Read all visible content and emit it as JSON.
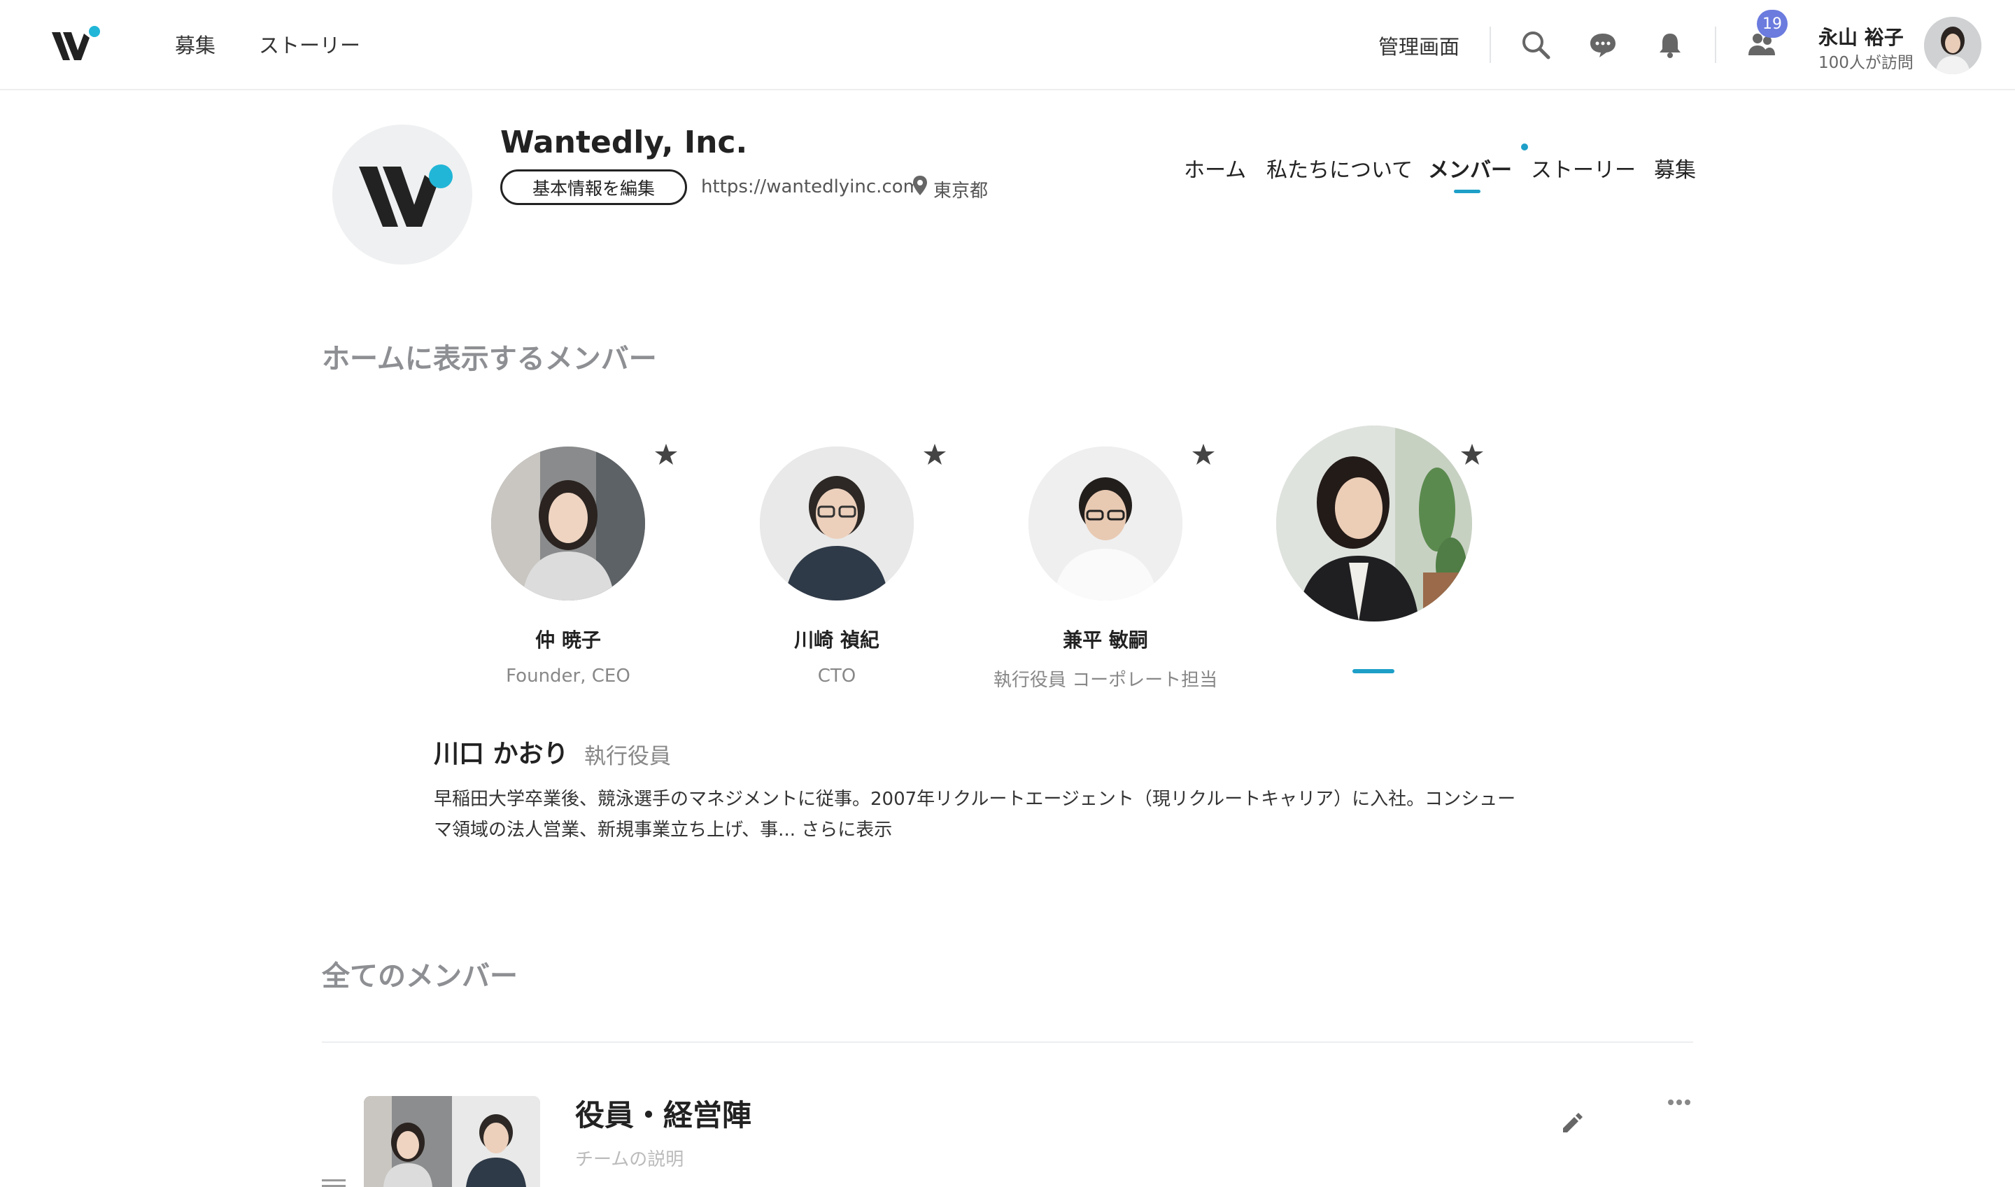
{
  "topnav": {
    "links": [
      "募集",
      "ストーリー"
    ],
    "admin_label": "管理画面",
    "visitor_badge": "19",
    "user_name": "永山 裕子",
    "user_sub": "100人が訪問"
  },
  "company": {
    "name": "Wantedly, Inc.",
    "edit_button": "基本情報を編集",
    "url": "https://wantedlyinc.com",
    "location": "東京都",
    "tabs": [
      "ホーム",
      "私たちについて",
      "メンバー",
      "ストーリー",
      "募集"
    ],
    "active_tab": "メンバー"
  },
  "featured": {
    "heading": "ホームに表示するメンバー",
    "members": [
      {
        "name": "仲 暁子",
        "role": "Founder, CEO"
      },
      {
        "name": "川崎 禎紀",
        "role": "CTO"
      },
      {
        "name": "兼平 敏嗣",
        "role": "執行役員 コーポレート担当"
      },
      {
        "name": "",
        "role": ""
      }
    ],
    "selected": {
      "name": "川口 かおり",
      "role": "執行役員",
      "description": "早稲田大学卒業後、競泳選手のマネジメントに従事。2007年リクルートエージェント（現リクルートキャリア）に入社。コンシューマ領域の法人営業、新規事業立ち上げ、事... さらに表示"
    }
  },
  "all_members": {
    "heading": "全てのメンバー",
    "teams": [
      {
        "name": "役員・経営陣",
        "description": "チームの説明"
      }
    ]
  },
  "colors": {
    "accent": "#1d9fc8",
    "badge": "#6b7bde",
    "heading_gray": "#8d8f93",
    "text": "#222222"
  }
}
